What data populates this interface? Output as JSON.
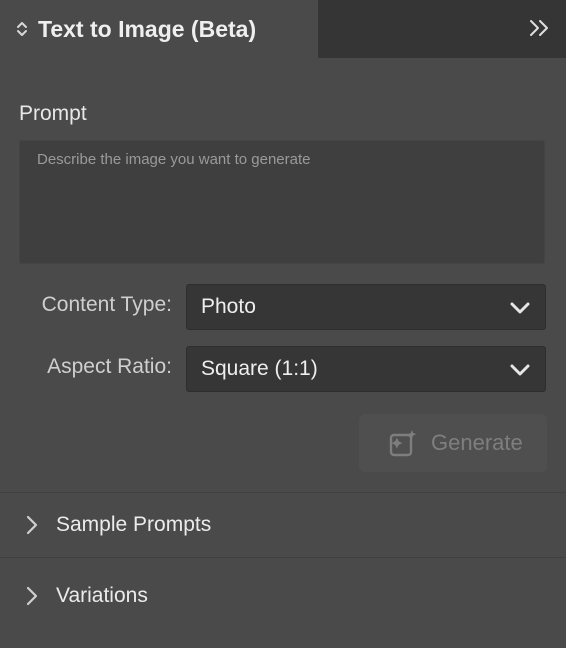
{
  "panel": {
    "title": "Text to Image (Beta)",
    "collapse_icon": "double-chevron-right-icon"
  },
  "prompt": {
    "label": "Prompt",
    "placeholder": "Describe the image you want to generate",
    "value": ""
  },
  "content_type": {
    "label": "Content Type:",
    "selected": "Photo"
  },
  "aspect_ratio": {
    "label": "Aspect Ratio:",
    "selected": "Square (1:1)"
  },
  "generate": {
    "label": "Generate",
    "icon": "sparkle-image-icon",
    "enabled": false
  },
  "sections": [
    {
      "label": "Sample Prompts",
      "expanded": false
    },
    {
      "label": "Variations",
      "expanded": false
    }
  ],
  "colors": {
    "panel_bg": "#4a4a4a",
    "tabbar_bg": "#353535",
    "field_bg": "#363636",
    "text": "#e6e6e6",
    "disabled_text": "#7e7e7e"
  }
}
